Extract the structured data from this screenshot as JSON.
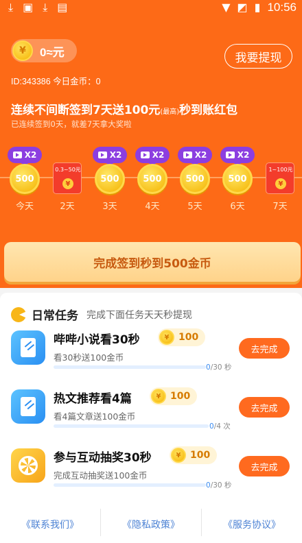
{
  "status_bar": {
    "time": "10:56",
    "icons": [
      "download-icon",
      "image-icon",
      "download-icon",
      "text-icon"
    ]
  },
  "header": {
    "coin_symbol": "¥",
    "balance": "0≈元",
    "withdraw_label": "我要提现",
    "id_line": "ID:343386 今日金币：0"
  },
  "signin": {
    "headline_a": "连续不间断签到7天送100元",
    "headline_small": "(最高)",
    "headline_b": "秒到账红包",
    "subline": "已连续签到0天，就差7天拿大奖啦",
    "days": [
      {
        "label": "今天",
        "kind": "coin",
        "value": "500",
        "badge": "X2"
      },
      {
        "label": "2天",
        "kind": "redpacket",
        "value": "0.3~50元"
      },
      {
        "label": "3天",
        "kind": "coin",
        "value": "500",
        "badge": "X2"
      },
      {
        "label": "4天",
        "kind": "coin",
        "value": "500",
        "badge": "X2"
      },
      {
        "label": "5天",
        "kind": "coin",
        "value": "500",
        "badge": "X2"
      },
      {
        "label": "6天",
        "kind": "coin",
        "value": "500",
        "badge": "X2"
      },
      {
        "label": "7天",
        "kind": "redpacket",
        "value": "1~100元"
      }
    ],
    "button_label": "完成签到秒到500金币"
  },
  "daily": {
    "title": "日常任务",
    "subtitle": "完成下面任务天天秒提现",
    "tasks": [
      {
        "name": "哔哔小说看30秒",
        "reward": "100",
        "desc": "看30秒送100金币",
        "done": "0",
        "total": "/30 秒",
        "progress": 0,
        "button": "去完成",
        "icon": "notebook-icon"
      },
      {
        "name": "热文推荐看4篇",
        "reward": "100",
        "desc": "看4篇文章送100金币",
        "done": "0",
        "total": "/4 次",
        "progress": 0,
        "button": "去完成",
        "icon": "notebook-icon"
      },
      {
        "name": "参与互动抽奖30秒",
        "reward": "100",
        "desc": "完成互动抽奖送100金币",
        "done": "0",
        "total": "/30 秒",
        "progress": 0,
        "button": "去完成",
        "icon": "lucky-wheel-icon"
      }
    ]
  },
  "footer": {
    "links": [
      "《联系我们》",
      "《隐私政策》",
      "《服务协议》"
    ]
  },
  "colors": {
    "brand_orange": "#fd6a17",
    "badge_purple": "#8c3ee0",
    "button_orange": "#ff6a1f",
    "link_blue": "#4c82d4"
  }
}
